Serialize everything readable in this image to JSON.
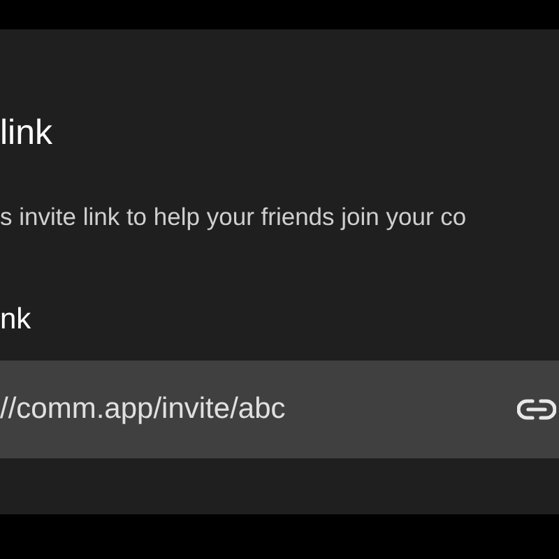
{
  "title": "link",
  "description": "s invite link to help your friends join your co",
  "field_label": "nk",
  "link_field": {
    "value": "//comm.app/invite/abc"
  }
}
